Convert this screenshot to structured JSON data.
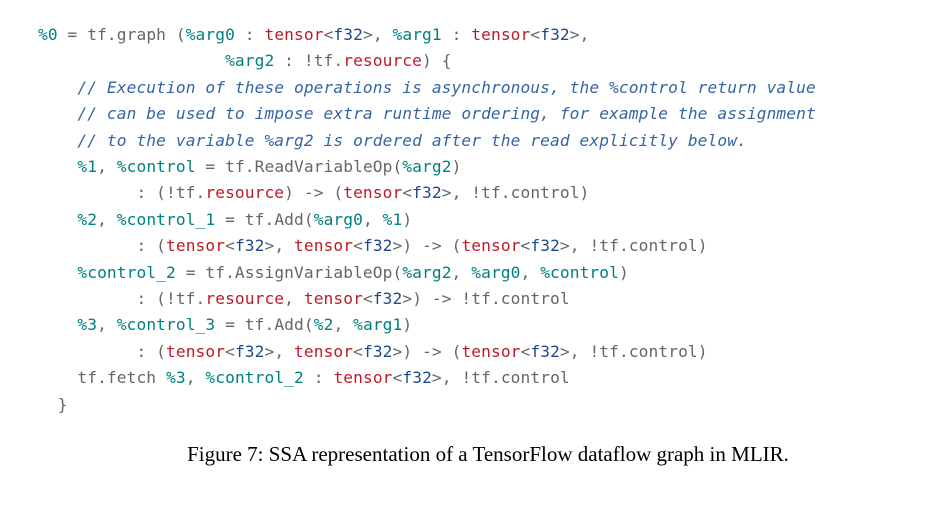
{
  "code": {
    "l01": {
      "a": "%0",
      "b": " = tf.graph (",
      "c": "%arg0",
      "d": " : ",
      "e": "tensor",
      "f": "<",
      "g": "f32",
      "h": ">, ",
      "i": "%arg1",
      "j": " : ",
      "k": "tensor",
      "l": "<",
      "m": "f32",
      "n": ">,"
    },
    "l02": {
      "a": "                   ",
      "b": "%arg2",
      "c": " : !tf.",
      "d": "resource",
      "e": ") {"
    },
    "l03": {
      "a": "    ",
      "b": "// Execution of these operations is asynchronous, the %control return value"
    },
    "l04": {
      "a": "    ",
      "b": "// can be used to impose extra runtime ordering, for example the assignment"
    },
    "l05": {
      "a": "    ",
      "b": "// to the variable %arg2 is ordered after the read explicitly below."
    },
    "l06": {
      "a": "    ",
      "b": "%1",
      "c": ", ",
      "d": "%control",
      "e": " = tf.ReadVariableOp(",
      "f": "%arg2",
      "g": ")"
    },
    "l07": {
      "a": "          : (!tf.",
      "b": "resource",
      "c": ") -> (",
      "d": "tensor",
      "e": "<",
      "f": "f32",
      "g": ">, !tf.control)"
    },
    "l08": {
      "a": "    ",
      "b": "%2",
      "c": ", ",
      "d": "%control_1",
      "e": " = tf.Add(",
      "f": "%arg0",
      "g": ", ",
      "h": "%1",
      "i": ")"
    },
    "l09": {
      "a": "          : (",
      "b": "tensor",
      "c": "<",
      "d": "f32",
      "e": ">, ",
      "f": "tensor",
      "g": "<",
      "h": "f32",
      "i": ">) -> (",
      "j": "tensor",
      "k": "<",
      "l": "f32",
      "m": ">, !tf.control)"
    },
    "l10": {
      "a": "    ",
      "b": "%control_2",
      "c": " = tf.AssignVariableOp(",
      "d": "%arg2",
      "e": ", ",
      "f": "%arg0",
      "g": ", ",
      "h": "%control",
      "i": ")"
    },
    "l11": {
      "a": "          : (!tf.",
      "b": "resource",
      "c": ", ",
      "d": "tensor",
      "e": "<",
      "f": "f32",
      "g": ">) -> !tf.control"
    },
    "l12": {
      "a": "    ",
      "b": "%3",
      "c": ", ",
      "d": "%control_3",
      "e": " = tf.Add(",
      "f": "%2",
      "g": ", ",
      "h": "%arg1",
      "i": ")"
    },
    "l13": {
      "a": "          : (",
      "b": "tensor",
      "c": "<",
      "d": "f32",
      "e": ">, ",
      "f": "tensor",
      "g": "<",
      "h": "f32",
      "i": ">) -> (",
      "j": "tensor",
      "k": "<",
      "l": "f32",
      "m": ">, !tf.control)"
    },
    "l14": {
      "a": "    ",
      "b": "tf.fetch ",
      "c": "%3",
      "d": ", ",
      "e": "%control_2",
      "f": " : ",
      "g": "tensor",
      "h": "<",
      "i": "f32",
      "j": ">, !tf.control"
    },
    "l15": {
      "a": "  }"
    }
  },
  "caption": "Figure 7: SSA representation of a TensorFlow dataflow graph in MLIR."
}
